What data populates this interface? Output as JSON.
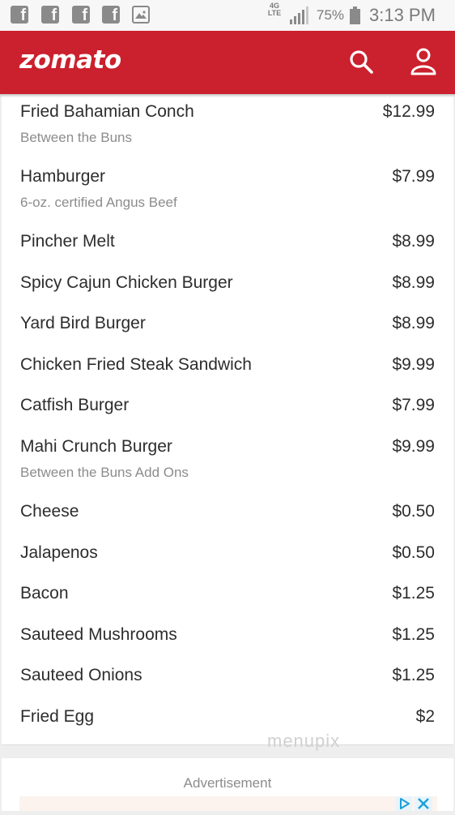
{
  "status_bar": {
    "notification_icons": [
      "facebook-icon",
      "facebook-icon",
      "facebook-icon",
      "facebook-icon",
      "gallery-icon"
    ],
    "fb_glyph": "f",
    "network": "4G LTE",
    "battery": "75%",
    "time": "3:13 PM"
  },
  "header": {
    "logo": "zomato",
    "brand_color": "#cb202d",
    "icons": [
      "search-icon",
      "user-icon"
    ]
  },
  "menu": {
    "items": [
      {
        "name": "Fried Bahamian Conch",
        "price": "$12.99",
        "description": "Between the Buns"
      },
      {
        "name": "Hamburger",
        "price": "$7.99",
        "description": "6-oz. certified Angus Beef"
      },
      {
        "name": "Pincher Melt",
        "price": "$8.99"
      },
      {
        "name": "Spicy Cajun Chicken Burger",
        "price": "$8.99"
      },
      {
        "name": "Yard Bird Burger",
        "price": "$8.99"
      },
      {
        "name": "Chicken Fried Steak Sandwich",
        "price": "$9.99"
      },
      {
        "name": "Catfish Burger",
        "price": "$7.99"
      },
      {
        "name": "Mahi Crunch Burger",
        "price": "$9.99",
        "description": "Between the Buns Add Ons"
      },
      {
        "name": "Cheese",
        "price": "$0.50"
      },
      {
        "name": "Jalapenos",
        "price": "$0.50"
      },
      {
        "name": "Bacon",
        "price": "$1.25"
      },
      {
        "name": "Sauteed Mushrooms",
        "price": "$1.25"
      },
      {
        "name": "Sauteed Onions",
        "price": "$1.25"
      },
      {
        "name": "Fried Egg",
        "price": "$2"
      }
    ],
    "watermark": "menupix"
  },
  "ad": {
    "label": "Advertisement"
  }
}
